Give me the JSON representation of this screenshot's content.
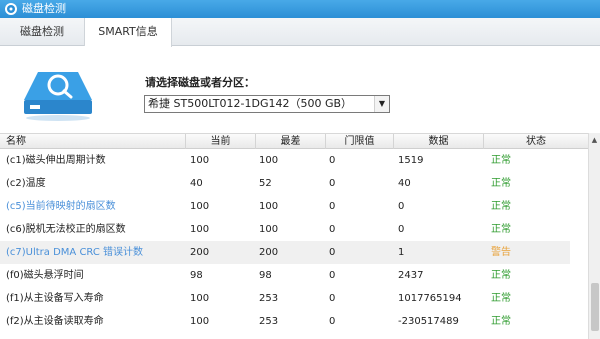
{
  "window": {
    "title": "磁盘检测"
  },
  "tabs": [
    {
      "label": "磁盘检测"
    },
    {
      "label": "SMART信息"
    }
  ],
  "selector": {
    "label": "请选择磁盘或者分区：",
    "value": "希捷 ST500LT012-1DG142（500 GB）"
  },
  "table": {
    "columns": [
      "名称",
      "当前",
      "最差",
      "门限值",
      "数据",
      "状态"
    ],
    "rows": [
      {
        "name": "(c1)磁头伸出周期计数",
        "current": "100",
        "worst": "100",
        "threshold": "0",
        "data": "1519",
        "status": "正常"
      },
      {
        "name": "(c2)温度",
        "current": "40",
        "worst": "52",
        "threshold": "0",
        "data": "40",
        "status": "正常"
      },
      {
        "name": "(c5)当前待映射的扇区数",
        "current": "100",
        "worst": "100",
        "threshold": "0",
        "data": "0",
        "status": "正常"
      },
      {
        "name": "(c6)脱机无法校正的扇区数",
        "current": "100",
        "worst": "100",
        "threshold": "0",
        "data": "0",
        "status": "正常"
      },
      {
        "name": "(c7)Ultra DMA CRC 错误计数",
        "current": "200",
        "worst": "200",
        "threshold": "0",
        "data": "1",
        "status": "警告"
      },
      {
        "name": "(f0)磁头悬浮时间",
        "current": "98",
        "worst": "98",
        "threshold": "0",
        "data": "2437",
        "status": "正常"
      },
      {
        "name": "(f1)从主设备写入寿命",
        "current": "100",
        "worst": "253",
        "threshold": "0",
        "data": "1017765194",
        "status": "正常"
      },
      {
        "name": "(f2)从主设备读取寿命",
        "current": "100",
        "worst": "253",
        "threshold": "0",
        "data": "-230517489",
        "status": "正常"
      }
    ]
  },
  "colors": {
    "titlebar": "#2c8fd6",
    "ok": "#2e9b2e",
    "warn": "#e8a23a",
    "link": "#4a90d9"
  },
  "icons": {
    "app": "disk-check-icon",
    "disk": "disk-search-icon"
  }
}
